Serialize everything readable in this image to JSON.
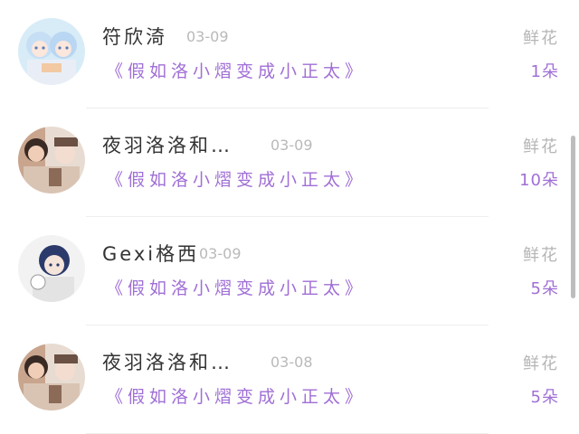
{
  "rows": [
    {
      "name": "符欣渏",
      "date": "03-09",
      "message": "《假如洛小熠变成小正太》",
      "gift": "鲜花",
      "count": "1朵",
      "avatar": "anime-twins-avatar"
    },
    {
      "name": "夜羽洛洛和…",
      "date": "03-09",
      "message": "《假如洛小熠变成小正太》",
      "gift": "鲜花",
      "count": "10朵",
      "avatar": "anime-couple-avatar"
    },
    {
      "name": "Gexi格西",
      "date": "03-09",
      "message": "《假如洛小熠变成小正太》",
      "gift": "鲜花",
      "count": "5朵",
      "avatar": "anime-boy-avatar"
    },
    {
      "name": "夜羽洛洛和…",
      "date": "03-08",
      "message": "《假如洛小熠变成小正太》",
      "gift": "鲜花",
      "count": "5朵",
      "avatar": "anime-couple-avatar"
    }
  ],
  "colors": {
    "accent": "#a06fd6",
    "muted": "#b9b9b9",
    "name": "#333333"
  }
}
